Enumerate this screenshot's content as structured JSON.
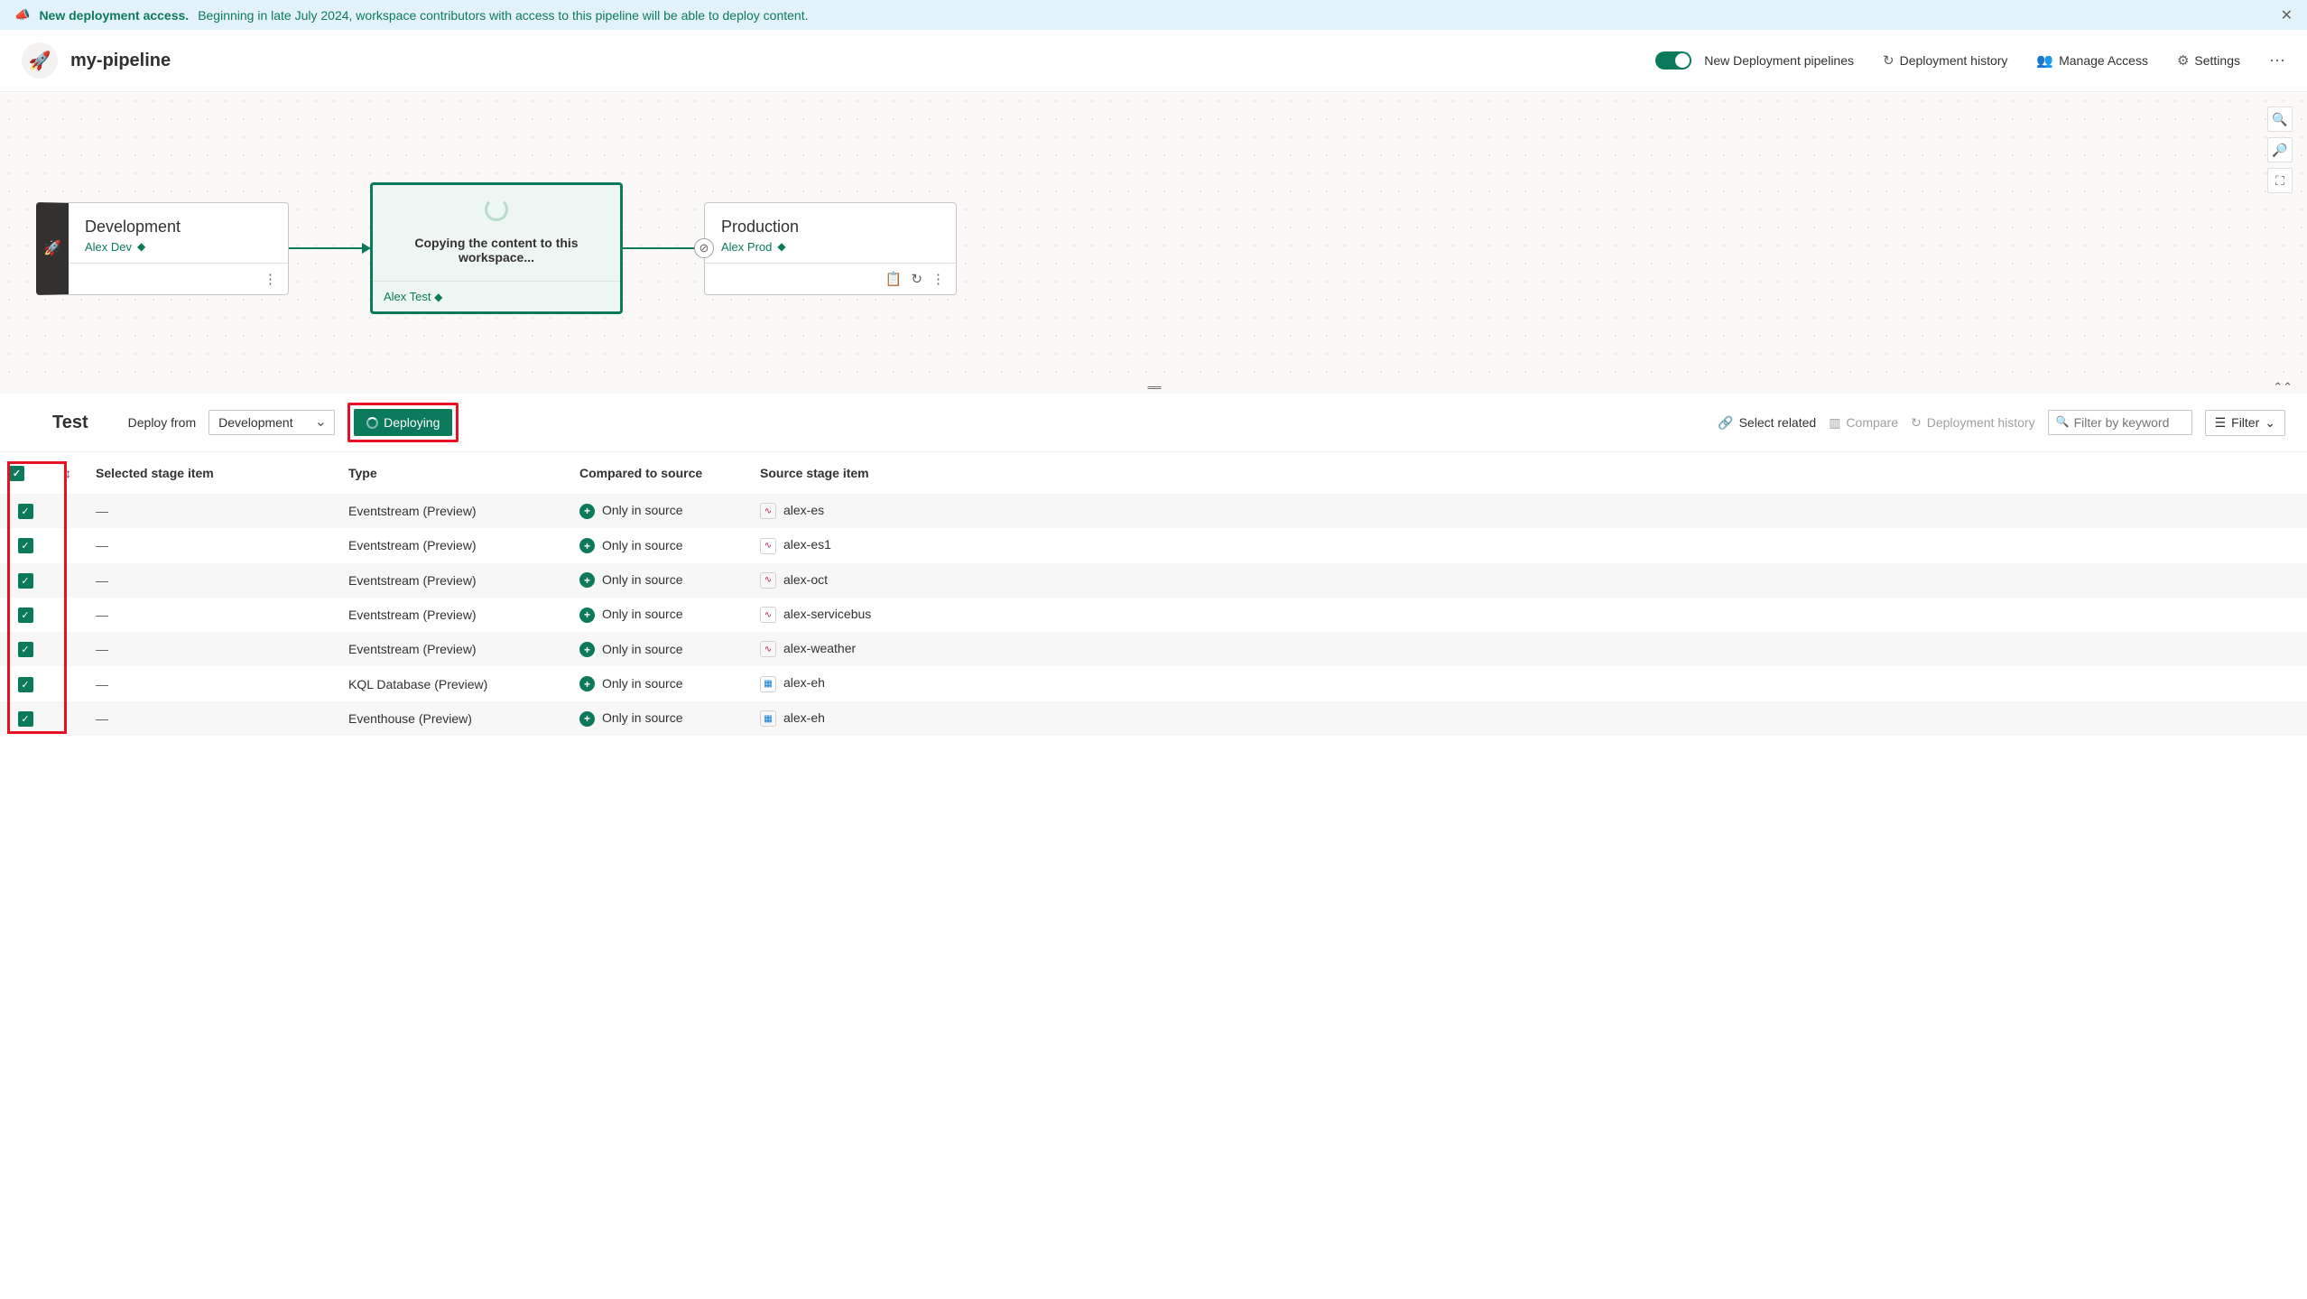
{
  "banner": {
    "title": "New deployment access.",
    "text": "Beginning in late July 2024, workspace contributors with access to this pipeline will be able to deploy content."
  },
  "header": {
    "title": "my-pipeline",
    "toggle_label": "New Deployment pipelines",
    "links": {
      "history": "Deployment history",
      "access": "Manage Access",
      "settings": "Settings"
    }
  },
  "stages": {
    "dev": {
      "title": "Development",
      "workspace": "Alex Dev"
    },
    "test": {
      "copying": "Copying the content to this workspace...",
      "workspace": "Alex Test"
    },
    "prod": {
      "title": "Production",
      "workspace": "Alex Prod"
    }
  },
  "toolbar": {
    "stage_title": "Test",
    "deploy_from_label": "Deploy from",
    "deploy_from_value": "Development",
    "deploy_button": "Deploying",
    "select_related": "Select related",
    "compare": "Compare",
    "history": "Deployment history",
    "filter_placeholder": "Filter by keyword",
    "filter_button": "Filter"
  },
  "table": {
    "columns": {
      "selected": "Selected stage item",
      "type": "Type",
      "compared": "Compared to source",
      "source": "Source stage item"
    },
    "compared_label": "Only in source",
    "rows": [
      {
        "selected": "—",
        "type": "Eventstream (Preview)",
        "icon": "es",
        "source": "alex-es"
      },
      {
        "selected": "—",
        "type": "Eventstream (Preview)",
        "icon": "es",
        "source": "alex-es1"
      },
      {
        "selected": "—",
        "type": "Eventstream (Preview)",
        "icon": "es",
        "source": "alex-oct"
      },
      {
        "selected": "—",
        "type": "Eventstream (Preview)",
        "icon": "es",
        "source": "alex-servicebus"
      },
      {
        "selected": "—",
        "type": "Eventstream (Preview)",
        "icon": "es",
        "source": "alex-weather"
      },
      {
        "selected": "—",
        "type": "KQL Database (Preview)",
        "icon": "db",
        "source": "alex-eh"
      },
      {
        "selected": "—",
        "type": "Eventhouse (Preview)",
        "icon": "db",
        "source": "alex-eh"
      }
    ]
  }
}
